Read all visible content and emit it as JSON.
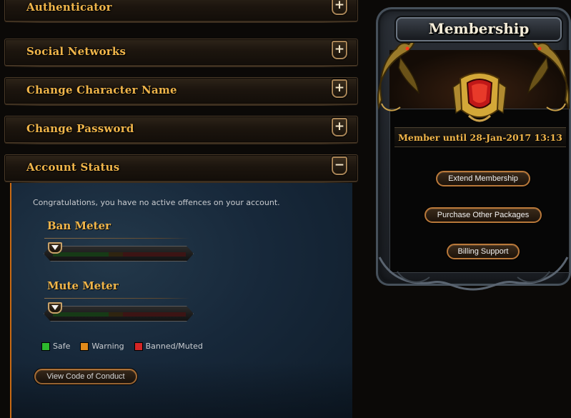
{
  "sections": {
    "authenticator": {
      "title": "Authenticator",
      "toggle": "+"
    },
    "social_networks": {
      "title": "Social Networks",
      "toggle": "+"
    },
    "change_character_name": {
      "title": "Change Character Name",
      "toggle": "+"
    },
    "change_password": {
      "title": "Change Password",
      "toggle": "+"
    },
    "account_status": {
      "title": "Account Status",
      "toggle": "−"
    }
  },
  "account_status": {
    "message": "Congratulations, you have no active offences on your account.",
    "ban_meter": {
      "title": "Ban Meter",
      "level": 0
    },
    "mute_meter": {
      "title": "Mute Meter",
      "level": 0
    },
    "legend": [
      {
        "label": "Safe",
        "color": "#2db82d"
      },
      {
        "label": "Warning",
        "color": "#e08a1a"
      },
      {
        "label": "Banned/Muted",
        "color": "#d42525"
      }
    ],
    "conduct_button": "View Code of Conduct"
  },
  "membership": {
    "title": "Membership",
    "until": "Member until 28-Jan-2017 13:13",
    "buttons": {
      "extend": "Extend Membership",
      "packages": "Purchase Other Packages",
      "billing": "Billing Support"
    }
  },
  "colors": {
    "accent_gold": "#f0b54a",
    "panel_blue": "#17283a",
    "button_border": "#b8783a"
  }
}
